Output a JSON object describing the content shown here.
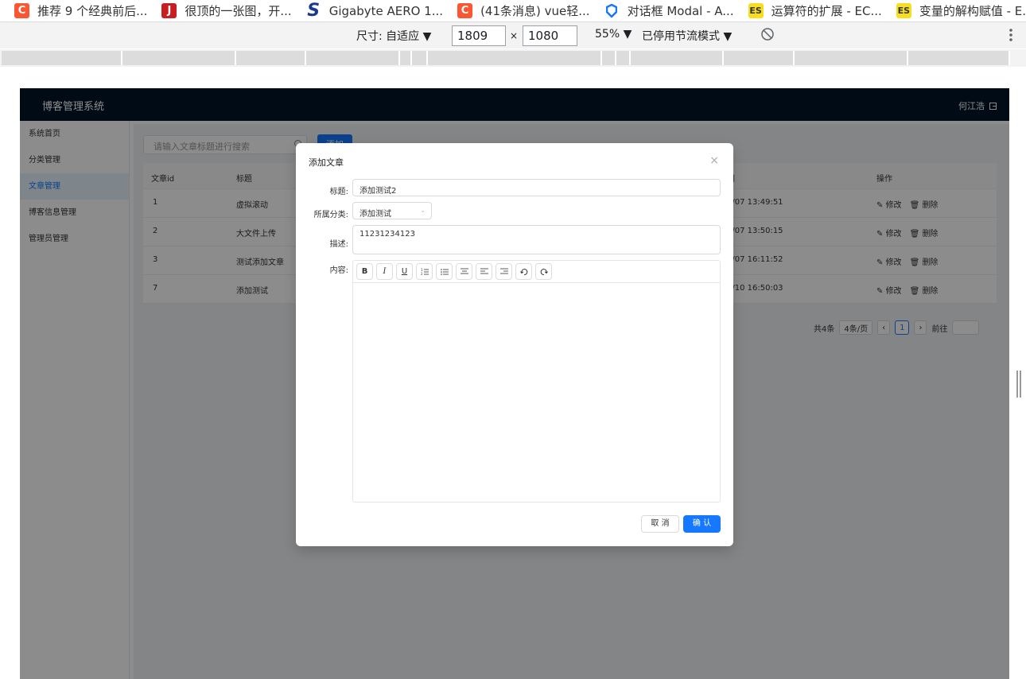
{
  "bookmarks": [
    {
      "label": "推荐 9 个经典前后...",
      "icon": "csdn-icon",
      "badge": "C"
    },
    {
      "label": "很顶的一张图，开...",
      "icon": "juejin-icon",
      "badge": "J"
    },
    {
      "label": "Gigabyte AERO 1...",
      "icon": "gigabyte-icon",
      "badge": "S"
    },
    {
      "label": "(41条消息) vue轻...",
      "icon": "csdn-icon",
      "badge": "C"
    },
    {
      "label": "对话框 Modal - A...",
      "icon": "antd-icon",
      "badge": ""
    },
    {
      "label": "运算符的扩展 - EC...",
      "icon": "es-icon",
      "badge": "ES"
    },
    {
      "label": "变量的解构赋值 - E...",
      "icon": "es-icon",
      "badge": "ES"
    }
  ],
  "devtools": {
    "dimensions_label": "尺寸: 自适应 ▼",
    "width": "1809",
    "times": "×",
    "height": "1080",
    "zoom": "55% ▼",
    "throttle": "已停用节流模式 ▼"
  },
  "app": {
    "title": "博客管理系统",
    "user": "何江浩",
    "sidebar": [
      "系统首页",
      "分类管理",
      "文章管理",
      "博客信息管理",
      "管理员管理"
    ],
    "search_placeholder": "请输入文章标题进行搜索",
    "add_label": "添加",
    "columns": {
      "id": "文章id",
      "title": "标题",
      "time": "间",
      "ops": "操作"
    },
    "rows": [
      {
        "id": "1",
        "title": "虚拟滚动",
        "time": "5/07 13:49:51"
      },
      {
        "id": "2",
        "title": "大文件上传",
        "time": "5/07 13:50:15"
      },
      {
        "id": "3",
        "title": "测试添加文章",
        "time": "5/07 16:11:52"
      },
      {
        "id": "7",
        "title": "添加测试",
        "time": "5/10 16:50:03"
      }
    ],
    "edit_label": "修改",
    "delete_label": "删除",
    "pager": {
      "total": "共4条",
      "page_size": "4条/页",
      "current": "1",
      "goto": "前往"
    }
  },
  "modal": {
    "title": "添加文章",
    "title_label": "标题:",
    "title_value": "添加测试2",
    "category_label": "所属分类:",
    "category_value": "添加测试",
    "desc_label": "描述:",
    "desc_value": "11231234123",
    "content_label": "内容:",
    "toolbar": [
      "B",
      "I",
      "U",
      "ol",
      "ul",
      "center",
      "left",
      "right",
      "undo",
      "redo"
    ],
    "cancel": "取 消",
    "confirm": "确 认"
  }
}
